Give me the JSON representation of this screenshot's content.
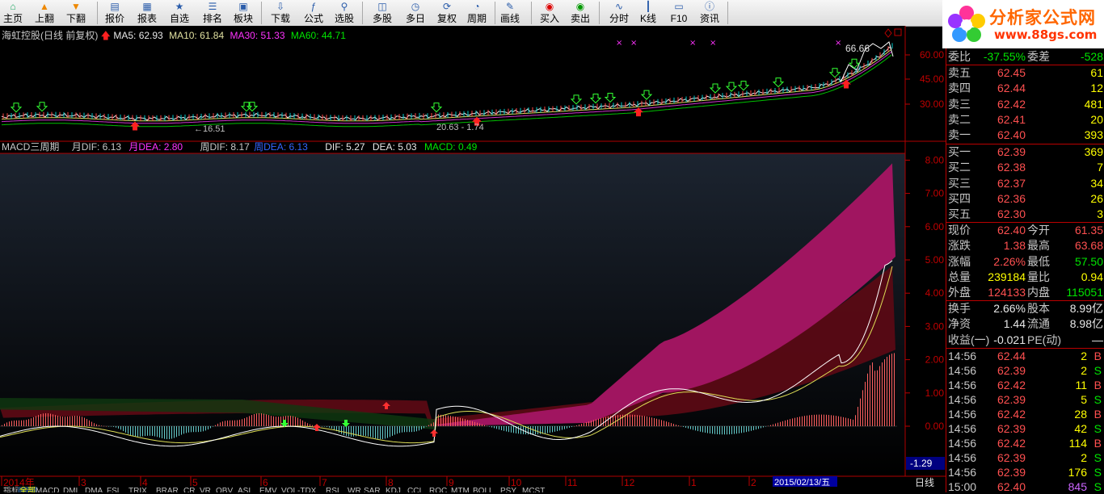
{
  "toolbar": {
    "items": [
      {
        "label": "主页",
        "icon": "home-icon"
      },
      {
        "label": "上翻",
        "icon": "page-up-icon"
      },
      {
        "label": "下翻",
        "icon": "page-down-icon"
      },
      {
        "label": "报价",
        "icon": "quote-icon"
      },
      {
        "label": "报表",
        "icon": "report-icon"
      },
      {
        "label": "自选",
        "icon": "favorites-icon"
      },
      {
        "label": "排名",
        "icon": "ranking-icon"
      },
      {
        "label": "板块",
        "icon": "sector-icon"
      },
      {
        "label": "下载",
        "icon": "download-icon"
      },
      {
        "label": "公式",
        "icon": "formula-icon"
      },
      {
        "label": "选股",
        "icon": "stock-picker-icon"
      },
      {
        "label": "多股",
        "icon": "multi-stock-icon"
      },
      {
        "label": "多日",
        "icon": "multi-day-icon"
      },
      {
        "label": "复权",
        "icon": "adjust-icon"
      },
      {
        "label": "周期",
        "icon": "period-icon"
      },
      {
        "label": "画线",
        "icon": "draw-line-icon"
      },
      {
        "label": "买入",
        "icon": "buy-icon"
      },
      {
        "label": "卖出",
        "icon": "sell-icon"
      },
      {
        "label": "分时",
        "icon": "intraday-icon"
      },
      {
        "label": "K线",
        "icon": "kline-icon"
      },
      {
        "label": "F10",
        "icon": "f10-icon"
      },
      {
        "label": "资讯",
        "icon": "news-icon"
      }
    ]
  },
  "logo": {
    "brand": "分析家公式网",
    "url": "www.88gs.com"
  },
  "main_chart": {
    "title": "海虹控股(日线 前复权)",
    "ma5_label": "MA5: 62.93",
    "ma10_label": "MA10: 61.84",
    "ma30_label": "MA30: 51.33",
    "ma60_label": "MA60: 44.71",
    "y_ticks": [
      "60.00",
      "45.00",
      "30.00"
    ],
    "high_label": "66.66",
    "low_labels": [
      "16.51",
      "20.63",
      "1.74"
    ],
    "colors": {
      "ma5": "#ffffff",
      "ma10": "#ffff00",
      "ma30": "#ff33ff",
      "ma60": "#00ff00"
    }
  },
  "macd_panel": {
    "title": "MACD三周期",
    "month_dif": "月DIF: 6.13",
    "month_dea": "月DEA: 2.80",
    "week_dif": "周DIF: 8.17",
    "week_dea": "周DEA: 6.13",
    "dif": "DIF: 5.27",
    "dea": "DEA: 5.03",
    "macd": "MACD: 0.49",
    "y_ticks": [
      "8.00",
      "7.00",
      "6.00",
      "5.00",
      "4.00",
      "3.00",
      "2.00",
      "1.00",
      "0.00"
    ],
    "cursor_value": "-1.29"
  },
  "date_axis": {
    "labels": [
      "2014年",
      "3",
      "4",
      "5",
      "6",
      "7",
      "8",
      "9",
      "10",
      "11",
      "12",
      "1",
      "2"
    ],
    "cursor_date": "2015/02/13/五",
    "period": "日线"
  },
  "indicator_tabs": [
    "指标",
    "全部",
    "MACD",
    "DMI",
    "DMA",
    "FSL",
    "TRIX",
    "BRAR",
    "CR",
    "VR",
    "OBV",
    "ASI",
    "EMV",
    "VOL-TDX",
    "RSI",
    "WR",
    "SAR",
    "KDJ",
    "CCI",
    "ROC",
    "MTM",
    "BOLL",
    "PSY",
    "MCST"
  ],
  "quote": {
    "weibi": {
      "label": "委比",
      "value": "-37.55%",
      "diff_label": "委差",
      "diff": "-528"
    },
    "sells": [
      {
        "label": "卖五",
        "price": "62.45",
        "vol": "61"
      },
      {
        "label": "卖四",
        "price": "62.44",
        "vol": "12"
      },
      {
        "label": "卖三",
        "price": "62.42",
        "vol": "481"
      },
      {
        "label": "卖二",
        "price": "62.41",
        "vol": "20"
      },
      {
        "label": "卖一",
        "price": "62.40",
        "vol": "393"
      }
    ],
    "buys": [
      {
        "label": "买一",
        "price": "62.39",
        "vol": "369"
      },
      {
        "label": "买二",
        "price": "62.38",
        "vol": "7"
      },
      {
        "label": "买三",
        "price": "62.37",
        "vol": "34"
      },
      {
        "label": "买四",
        "price": "62.36",
        "vol": "26"
      },
      {
        "label": "买五",
        "price": "62.30",
        "vol": "3"
      }
    ],
    "stats": [
      {
        "l1": "现价",
        "v1": "62.40",
        "l2": "今开",
        "v2": "61.35"
      },
      {
        "l1": "涨跌",
        "v1": "1.38",
        "l2": "最高",
        "v2": "63.68"
      },
      {
        "l1": "涨幅",
        "v1": "2.26%",
        "l2": "最低",
        "v2": "57.50"
      },
      {
        "l1": "总量",
        "v1": "239184",
        "l2": "量比",
        "v2": "0.94"
      },
      {
        "l1": "外盘",
        "v1": "124133",
        "l2": "内盘",
        "v2": "115051"
      }
    ],
    "stats2": [
      {
        "l1": "换手",
        "v1": "2.66%",
        "l2": "股本",
        "v2": "8.99亿"
      },
      {
        "l1": "净资",
        "v1": "1.44",
        "l2": "流通",
        "v2": "8.98亿"
      },
      {
        "l1": "收益(一)",
        "v1": "-0.021",
        "l2": "PE(动)",
        "v2": "—"
      }
    ],
    "ticks": [
      {
        "time": "14:56",
        "price": "62.44",
        "vol": "2",
        "side": "B"
      },
      {
        "time": "14:56",
        "price": "62.39",
        "vol": "2",
        "side": "S"
      },
      {
        "time": "14:56",
        "price": "62.42",
        "vol": "11",
        "side": "B"
      },
      {
        "time": "14:56",
        "price": "62.39",
        "vol": "5",
        "side": "S"
      },
      {
        "time": "14:56",
        "price": "62.42",
        "vol": "28",
        "side": "B"
      },
      {
        "time": "14:56",
        "price": "62.39",
        "vol": "42",
        "side": "S"
      },
      {
        "time": "14:56",
        "price": "62.42",
        "vol": "114",
        "side": "B"
      },
      {
        "time": "14:56",
        "price": "62.39",
        "vol": "2",
        "side": "S"
      },
      {
        "time": "14:56",
        "price": "62.39",
        "vol": "176",
        "side": "S"
      },
      {
        "time": "15:00",
        "price": "62.40",
        "vol": "845",
        "side": "S"
      }
    ]
  }
}
